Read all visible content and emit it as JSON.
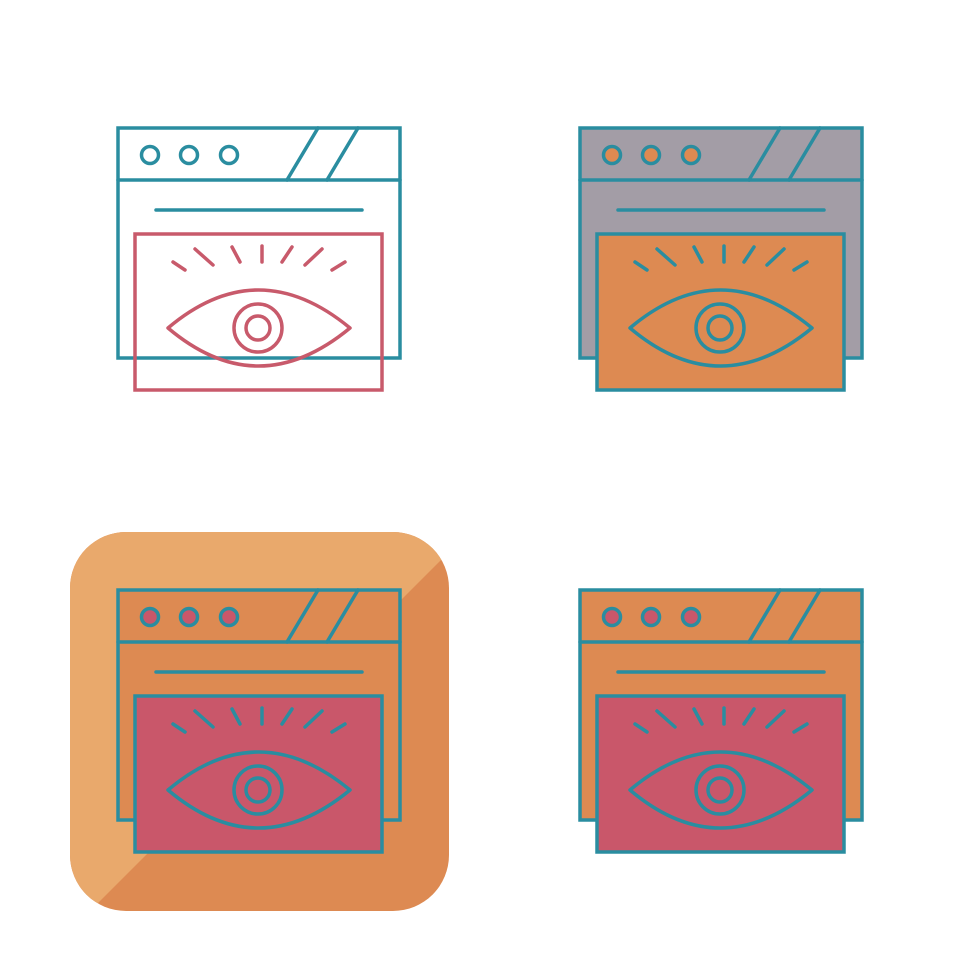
{
  "colors": {
    "teal": "#2a8da0",
    "rose": "#c85a6b",
    "gray": "#a39da6",
    "orange": "#dd8a52",
    "orange_light": "#e9a96c",
    "red": "#c9576a",
    "background": "#ffffff"
  },
  "icons": [
    {
      "name": "browser-eye-outline-icon",
      "style": "outline",
      "window_fill": "none",
      "panel_fill": "none",
      "stroke": "#2a8da0",
      "eye_stroke": "#c85a6b"
    },
    {
      "name": "browser-eye-filled-gray-icon",
      "style": "filled",
      "window_fill": "#a39da6",
      "panel_fill": "#dd8a52",
      "stroke": "#2a8da0",
      "eye_stroke": "#2a8da0"
    },
    {
      "name": "browser-eye-badge-icon",
      "style": "badge",
      "window_fill": "#dd8a52",
      "panel_fill": "#c9576a",
      "stroke": "#2a8da0",
      "eye_stroke": "#2a8da0"
    },
    {
      "name": "browser-eye-filled-orange-icon",
      "style": "filled",
      "window_fill": "#dd8a52",
      "panel_fill": "#c9576a",
      "stroke": "#2a8da0",
      "eye_stroke": "#2a8da0"
    }
  ]
}
